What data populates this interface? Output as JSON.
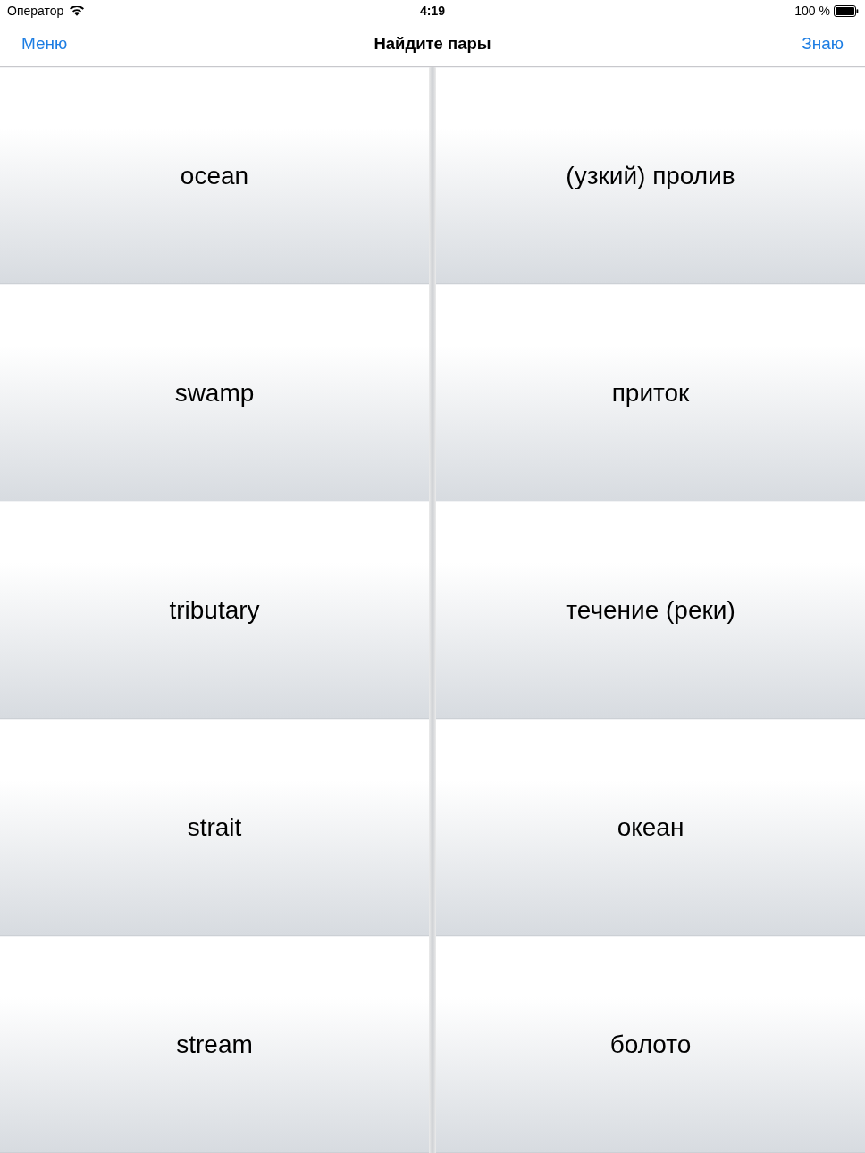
{
  "status_bar": {
    "carrier": "Оператор",
    "time": "4:19",
    "battery": "100 %"
  },
  "nav_bar": {
    "left_button": "Меню",
    "title": "Найдите пары",
    "right_button": "Знаю"
  },
  "rows": [
    {
      "term": "ocean",
      "translation": "(узкий) пролив"
    },
    {
      "term": "swamp",
      "translation": "приток"
    },
    {
      "term": "tributary",
      "translation": "течение (реки)"
    },
    {
      "term": "strait",
      "translation": "океан"
    },
    {
      "term": "stream",
      "translation": "болото"
    }
  ]
}
